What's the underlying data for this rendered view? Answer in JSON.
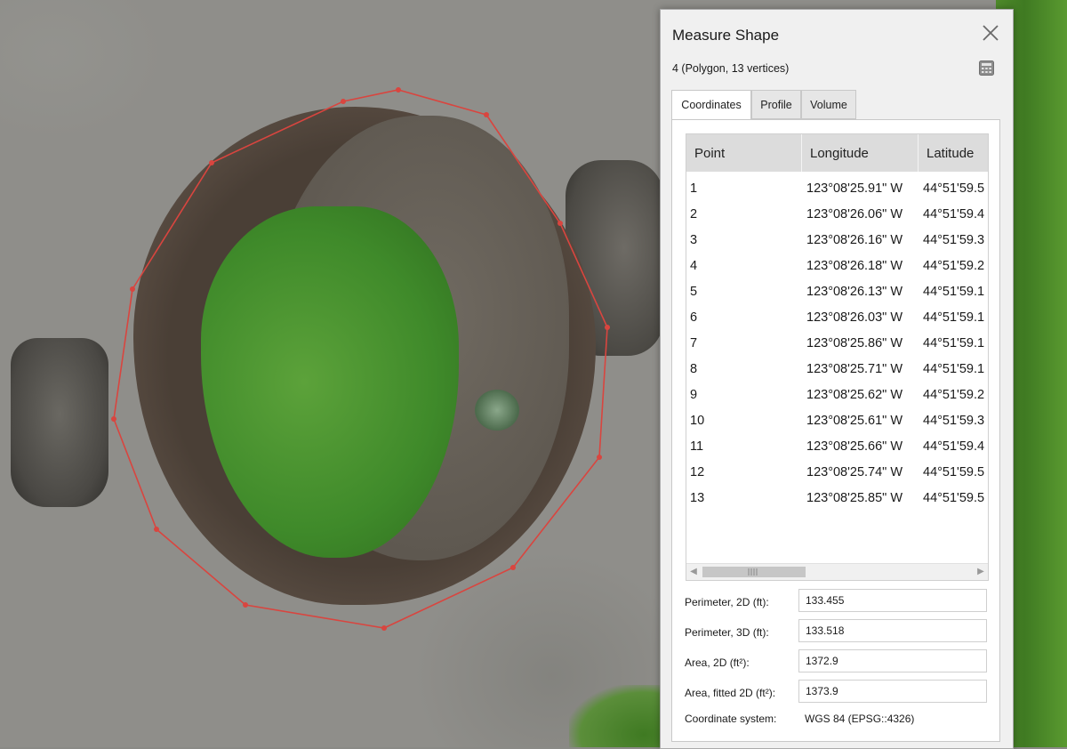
{
  "dialog": {
    "title": "Measure Shape",
    "subtitle": "4 (Polygon, 13 vertices)",
    "close_icon": "close-icon",
    "calculator_icon": "calculator-icon"
  },
  "tabs": [
    {
      "label": "Coordinates",
      "active": true
    },
    {
      "label": "Profile",
      "active": false
    },
    {
      "label": "Volume",
      "active": false
    }
  ],
  "table": {
    "headers": [
      "Point",
      "Longitude",
      "Latitude"
    ],
    "rows": [
      {
        "point": "1",
        "lon": "123°08'25.91\" W",
        "lat": "44°51'59.5"
      },
      {
        "point": "2",
        "lon": "123°08'26.06\" W",
        "lat": "44°51'59.4"
      },
      {
        "point": "3",
        "lon": "123°08'26.16\" W",
        "lat": "44°51'59.3"
      },
      {
        "point": "4",
        "lon": "123°08'26.18\" W",
        "lat": "44°51'59.2"
      },
      {
        "point": "5",
        "lon": "123°08'26.13\" W",
        "lat": "44°51'59.1"
      },
      {
        "point": "6",
        "lon": "123°08'26.03\" W",
        "lat": "44°51'59.1"
      },
      {
        "point": "7",
        "lon": "123°08'25.86\" W",
        "lat": "44°51'59.1"
      },
      {
        "point": "8",
        "lon": "123°08'25.71\" W",
        "lat": "44°51'59.1"
      },
      {
        "point": "9",
        "lon": "123°08'25.62\" W",
        "lat": "44°51'59.2"
      },
      {
        "point": "10",
        "lon": "123°08'25.61\" W",
        "lat": "44°51'59.3"
      },
      {
        "point": "11",
        "lon": "123°08'25.66\" W",
        "lat": "44°51'59.4"
      },
      {
        "point": "12",
        "lon": "123°08'25.74\" W",
        "lat": "44°51'59.5"
      },
      {
        "point": "13",
        "lon": "123°08'25.85\" W",
        "lat": "44°51'59.5"
      }
    ]
  },
  "fields": {
    "perimeter_2d_label": "Perimeter, 2D (ft):",
    "perimeter_2d_value": "133.455",
    "perimeter_3d_label": "Perimeter, 3D (ft):",
    "perimeter_3d_value": "133.518",
    "area_2d_label": "Area, 2D (ft²):",
    "area_2d_value": "1372.9",
    "area_fitted_label": "Area, fitted 2D (ft²):",
    "area_fitted_value": "1373.9",
    "crs_label": "Coordinate system:",
    "crs_value": "WGS 84 (EPSG::4326)"
  },
  "colors": {
    "polygon_outline": "#d9453f",
    "dialog_bg": "#f0f0f0",
    "header_bg": "#dcdcdc"
  }
}
